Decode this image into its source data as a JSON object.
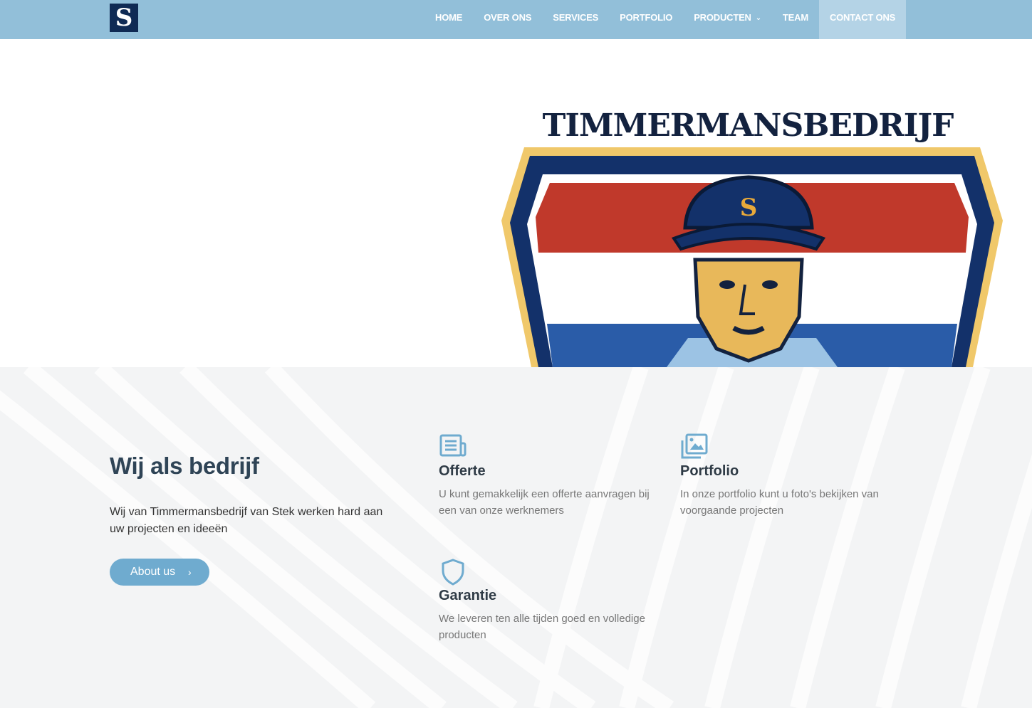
{
  "header": {
    "logo_letter": "S",
    "nav": [
      {
        "label": "HOME",
        "active": false
      },
      {
        "label": "OVER ONS",
        "active": false
      },
      {
        "label": "SERVICES",
        "active": false
      },
      {
        "label": "PORTFOLIO",
        "active": false
      },
      {
        "label": "PRODUCTEN",
        "active": false,
        "dropdown": true
      },
      {
        "label": "TEAM",
        "active": false
      },
      {
        "label": "CONTACT ONS",
        "active": true
      }
    ],
    "dropdown_icon": "chevron-down-icon",
    "colors": {
      "bar": "#92bfd9",
      "active": "#b4d3e6"
    }
  },
  "hero": {
    "logo_text": "TIMMERMANSBEDRIJF",
    "logo_letter": "S",
    "colors": {
      "navy": "#13316a",
      "red": "#c0392b",
      "blue": "#2a5ca8",
      "gold": "#f0c86a"
    }
  },
  "about": {
    "title": "Wij als bedrijf",
    "text": "Wij van Timmermansbedrijf van Stek werken hard aan uw projecten en ideeën",
    "button_label": "About us",
    "button_icon": "chevron-right-icon",
    "button_color": "#6fabcf"
  },
  "features": [
    {
      "icon": "newspaper-icon",
      "title": "Offerte",
      "text": "U kunt gemakkelijk een offerte aanvragen bij een van onze werknemers"
    },
    {
      "icon": "images-icon",
      "title": "Portfolio",
      "text": "In onze portfolio kunt u foto's bekijken van voorgaande projecten"
    },
    {
      "icon": "shield-icon",
      "title": "Garantie",
      "text": "We leveren ten alle tijden goed en volledige producten"
    }
  ],
  "accent_color": "#6fabcf"
}
